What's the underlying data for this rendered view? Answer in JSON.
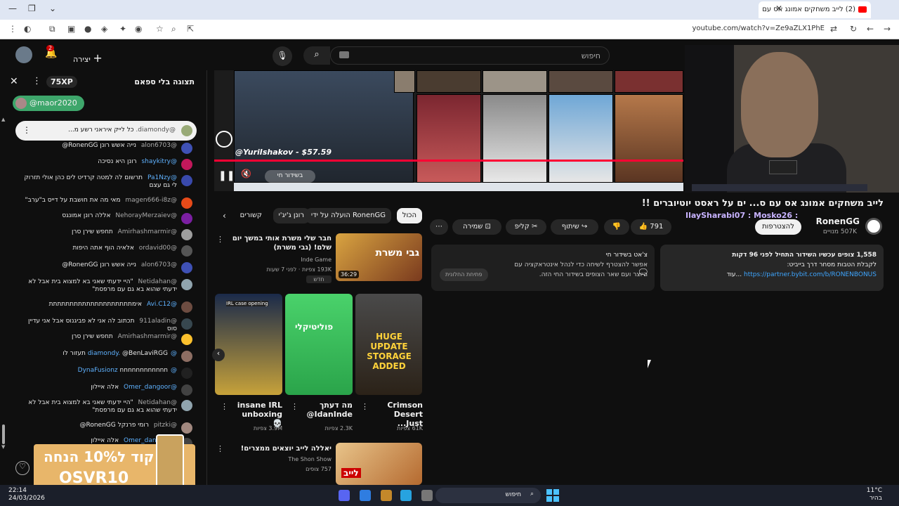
{
  "browser": {
    "tab_title": "(2) לייב משחקים אמונג אס עם",
    "url": "youtube.com/watch?v=Ze9aZLX1PhE"
  },
  "header": {
    "create_label": "יצירה",
    "notification_count": "2",
    "search_placeholder": "חיפוש"
  },
  "chat": {
    "title": "תצוגה בלי ספאם",
    "xp": "75XP",
    "mention_chip": "@maor2020",
    "pinned_author": "@diamondy.",
    "pinned_text": "כל לייק איראני רשע מ...",
    "messages": [
      {
        "author": "@alon6703",
        "text": "נייה אשש רונן RonenGG@",
        "color": "#3f51b5"
      },
      {
        "author": "@shaykitry",
        "text": "רונן היא נסיכה",
        "color": "#c2185b",
        "highlight": true
      },
      {
        "author": "@Pa1Nzy",
        "text": "תרשום לה למטה קרדיט לים כהן אולי תזרוק לי גם עצם",
        "color": "#3949ab",
        "highlight": true
      },
      {
        "author": "@magen666-i8z",
        "text": "מאי מה את חושבת על דייס ב\"ערב\"",
        "color": "#e64a19"
      },
      {
        "author": "@NehorayMerzaiev",
        "text": "אללה רונן אמונגס",
        "color": "#7b1fa2"
      },
      {
        "author": "@Amirhashmarmir",
        "text": "תחפש שירן סרן",
        "color": "#9e9e9e"
      },
      {
        "author": "@ordavid00",
        "text": "אלאיה הוף אתה היפות",
        "color": "#555"
      },
      {
        "author": "@alon6703",
        "text": "נייה אשש רונן RonenGG@",
        "color": "#3f51b5"
      },
      {
        "author": "@Netidahan",
        "text": "\"היי ידעתי שאני בא למצוא בית אבל לא ידעתי שהוא בא גם עם מרפסת\"",
        "color": "#90a4ae"
      },
      {
        "author": "@Avi.C12",
        "text": "אימתתתתתתתתתתתתתתתתתתתת",
        "color": "#6d4c41",
        "highlight": true
      },
      {
        "author": "@911aladin",
        "text": "תכתוב לה אני לא פביגנוס אבל אני עדיין סוס",
        "color": "#37474f"
      },
      {
        "author": "@Amirhashmarmir",
        "text": "תחפש שירן סרן",
        "color": "#fbc02d"
      },
      {
        "author": "@diamondy.",
        "text": "@BenLaviRGG תעזור לו",
        "color": "#8d6e63",
        "highlight": true
      },
      {
        "author": "@DynaFusionz",
        "text": "nnnnnnnnnnnn",
        "color": "#212121",
        "highlight": true
      },
      {
        "author": "@Omer_dangoor",
        "text": "אלה איילון",
        "color": "#424242",
        "highlight": true
      },
      {
        "author": "@Netidahan",
        "text": "\"היי ידעתי שאני בא למצוא בית אבל לא ידעתי שהוא בא גם עם מרפסת\"",
        "color": "#90a4ae"
      },
      {
        "author": "@pitzki",
        "text": "רומי פרנקל RonenGG@",
        "color": "#a1887f"
      },
      {
        "author": "@Omer_dangoor",
        "text": "אלה איילון",
        "color": "#424242",
        "highlight": true
      }
    ],
    "promo_line1": "קוד ל10% הנחה",
    "promo_line2": "OSVR10"
  },
  "player": {
    "handle": "@YuriIshakov - $57.59",
    "live_label": "בשידור חי"
  },
  "video": {
    "title": "לייב משחקים אמונג אס עם ס... ים על ראסט יוטיוברים !!",
    "overlay_names": "IlaySharabi07 : Mosko26 :",
    "channel_name": "RonenGG",
    "subscribers": "507K מנויים",
    "subscribe_label": "להצטרפות",
    "like_count": "791",
    "share_label": "שיתוף",
    "clip_label": "קליפ",
    "save_label": "שמירה"
  },
  "description": {
    "line1": "1,558 צופים עכשיו  השידור התחיל לפני 96 דקות",
    "line2": "לקבלת הטבות מסחר דרך בייביט:",
    "link": "https://partner.bybit.com/b/RONENBONUS",
    "more": "...עוד"
  },
  "livechat_box": {
    "title": "צ'אט בשידור חי",
    "text": "אפשר להצטרף לשיחה כדי לנהל אינטראקציה עם היוצר ועם שאר הצופים בשידור החי הזה.",
    "open_label": "פתיחת החלונית"
  },
  "filters": [
    "הכול",
    "הועלה על ידי RonenGG",
    "רונן ג'יג'י",
    "קשורים"
  ],
  "recommendations": {
    "top": {
      "title": "חבר שלי משרת אותי במשך יום שלם! (גבי משרת)",
      "channel": "Inde Game",
      "meta": "193K צפיות · לפני 7 שעות",
      "badge": "חדש",
      "duration": "36:29",
      "thumb_text": "גבי משרת"
    },
    "shorts": [
      {
        "title": "Crimson Desert Just...",
        "views": "61K צפיות",
        "thumb_text": "HUGE UPDATE STORAGE ADDED"
      },
      {
        "title": "מה דעתך IdanInde@",
        "views": "2.3K צפיות",
        "thumb_text": "פוליטיקלי"
      },
      {
        "title": "insane IRL unboxing 💀",
        "views": "3.9M צפיות",
        "thumb_text": "IRL case opening"
      }
    ],
    "bottom": {
      "title": "יאללה לייב יוצאים ממצרים!",
      "channel": "The Shon Show",
      "meta": "757 צופים",
      "thumb_text": "לייב"
    }
  },
  "taskbar": {
    "time": "22:14",
    "date": "24/03/2026",
    "search": "חיפוש",
    "temp": "11°C",
    "weather": "בהיר"
  },
  "colors": {
    "accent_red": "#ff0033",
    "chip_green": "#3ea66b",
    "link_blue": "#3ea6ff"
  }
}
